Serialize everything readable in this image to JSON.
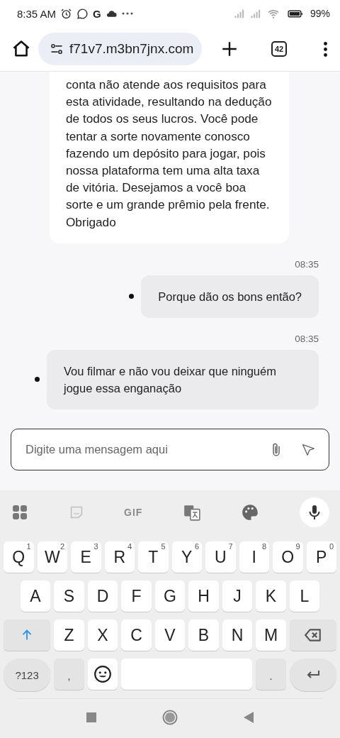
{
  "status_bar": {
    "time": "8:35 AM",
    "app_letter": "G",
    "battery": "99%"
  },
  "browser": {
    "url": "f71v7.m3bn7jnx.com",
    "tab_count": "42"
  },
  "messages": [
    {
      "kind": "received",
      "text": "conta não atende aos requisitos para esta atividade, resultando na dedução de todos os seus lucros. Você pode tentar a sorte novamente conosco fazendo um depósito para jogar, pois nossa plataforma tem uma alta taxa de vitória. Desejamos a você boa sorte e um grande prêmio pela frente. Obrigado"
    },
    {
      "kind": "sent",
      "time": "08:35",
      "text": "Porque dão os bons então?"
    },
    {
      "kind": "sent",
      "time": "08:35",
      "text": "Vou filmar e não vou deixar que ninguém jogue essa enganação"
    }
  ],
  "composer": {
    "placeholder": "Digite uma mensagem aqui"
  },
  "keyboard": {
    "gif_label": "GIF",
    "rows": [
      {
        "keys": [
          {
            "kind": "letter",
            "label": "Q",
            "hint": "1"
          },
          {
            "kind": "letter",
            "label": "W",
            "hint": "2"
          },
          {
            "kind": "letter",
            "label": "E",
            "hint": "3"
          },
          {
            "kind": "letter",
            "label": "R",
            "hint": "4"
          },
          {
            "kind": "letter",
            "label": "T",
            "hint": "5"
          },
          {
            "kind": "letter",
            "label": "Y",
            "hint": "6"
          },
          {
            "kind": "letter",
            "label": "U",
            "hint": "7"
          },
          {
            "kind": "letter",
            "label": "I",
            "hint": "8"
          },
          {
            "kind": "letter",
            "label": "O",
            "hint": "9"
          },
          {
            "kind": "letter",
            "label": "P",
            "hint": "0"
          }
        ]
      },
      {
        "keys": [
          {
            "kind": "letter",
            "label": "A"
          },
          {
            "kind": "letter",
            "label": "S"
          },
          {
            "kind": "letter",
            "label": "D"
          },
          {
            "kind": "letter",
            "label": "F"
          },
          {
            "kind": "letter",
            "label": "G"
          },
          {
            "kind": "letter",
            "label": "H"
          },
          {
            "kind": "letter",
            "label": "J"
          },
          {
            "kind": "letter",
            "label": "K"
          },
          {
            "kind": "letter",
            "label": "L"
          }
        ]
      },
      {
        "keys": [
          {
            "kind": "shift"
          },
          {
            "kind": "letter",
            "label": "Z"
          },
          {
            "kind": "letter",
            "label": "X"
          },
          {
            "kind": "letter",
            "label": "C"
          },
          {
            "kind": "letter",
            "label": "V"
          },
          {
            "kind": "letter",
            "label": "B"
          },
          {
            "kind": "letter",
            "label": "N"
          },
          {
            "kind": "letter",
            "label": "M"
          },
          {
            "kind": "backspace"
          }
        ]
      },
      {
        "keys": [
          {
            "kind": "symbols",
            "label": "?123"
          },
          {
            "kind": "punct",
            "label": ","
          },
          {
            "kind": "emoji"
          },
          {
            "kind": "space"
          },
          {
            "kind": "punct",
            "label": "."
          },
          {
            "kind": "enter"
          }
        ]
      }
    ]
  }
}
